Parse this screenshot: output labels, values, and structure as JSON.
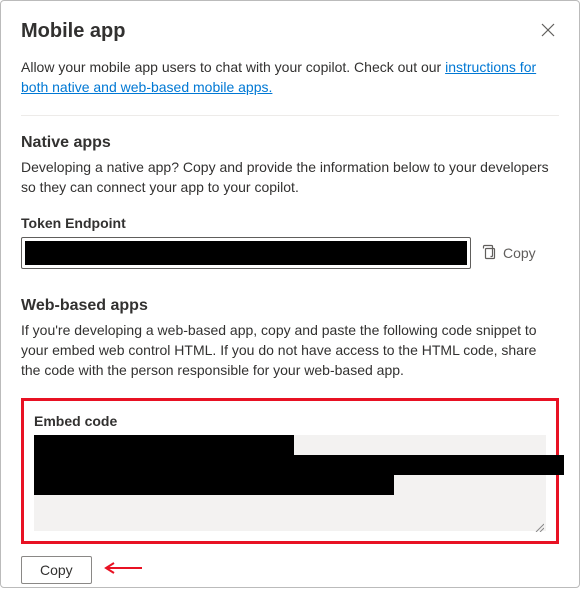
{
  "header": {
    "title": "Mobile app"
  },
  "intro": {
    "text_before": "Allow your mobile app users to chat with your copilot. Check out our ",
    "link_text": "instructions for both native and web-based mobile apps."
  },
  "native": {
    "title": "Native apps",
    "desc": "Developing a native app? Copy and provide the information below to your developers so they can connect your app to your copilot.",
    "token_label": "Token Endpoint",
    "copy_label": "Copy"
  },
  "web": {
    "title": "Web-based apps",
    "desc": "If you're developing a web-based app, copy and paste the following code snippet to your embed web control HTML. If you do not have access to the HTML code, share the code with the person responsible for your web-based app.",
    "embed_label": "Embed code",
    "copy_btn": "Copy"
  }
}
